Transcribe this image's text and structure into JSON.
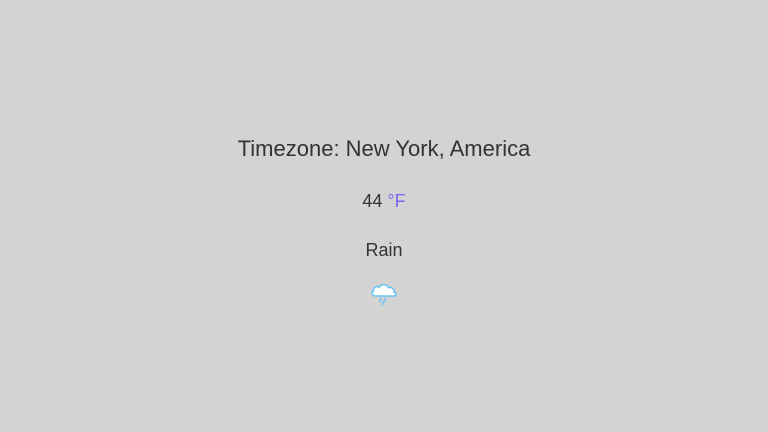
{
  "weather": {
    "timezone_text": "Timezone: New York, America",
    "temperature_value": "44",
    "temperature_unit": "°F",
    "condition": "Rain",
    "icon": "rain-cloud-icon"
  },
  "colors": {
    "background": "#d3d3d3",
    "text": "#333333",
    "unit_accent": "#7b68ee",
    "icon_cloud": "#6ec6f0"
  }
}
